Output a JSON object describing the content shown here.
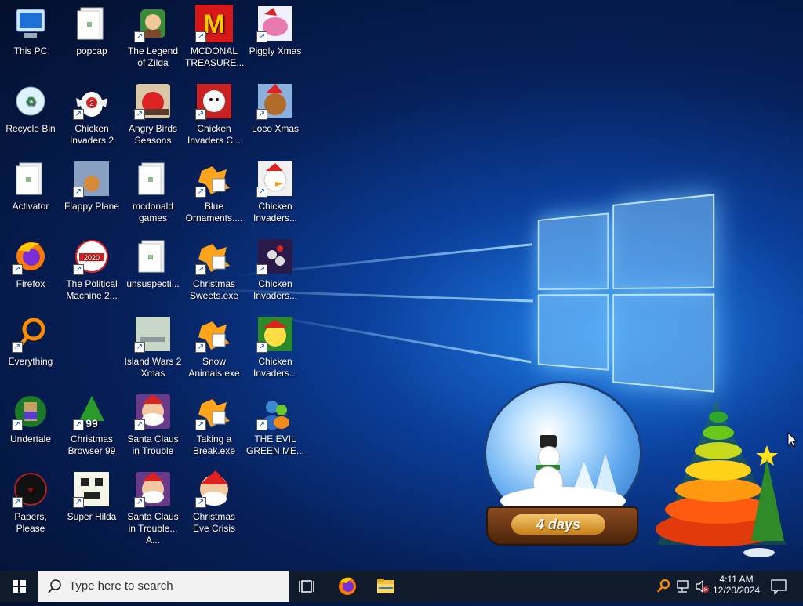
{
  "desktop": {
    "icons": [
      {
        "label": "This PC",
        "col": 0,
        "row": 0,
        "kind": "pc",
        "shortcut": false
      },
      {
        "label": "Recycle Bin",
        "col": 0,
        "row": 1,
        "kind": "bin",
        "shortcut": false
      },
      {
        "label": "Activator",
        "col": 0,
        "row": 2,
        "kind": "folder",
        "shortcut": false
      },
      {
        "label": "Firefox",
        "col": 0,
        "row": 3,
        "kind": "firefox",
        "shortcut": true
      },
      {
        "label": "Everything",
        "col": 0,
        "row": 4,
        "kind": "everything",
        "shortcut": true
      },
      {
        "label": "Undertale",
        "col": 0,
        "row": 5,
        "kind": "undertale",
        "shortcut": true
      },
      {
        "label": "Papers, Please",
        "col": 0,
        "row": 6,
        "kind": "papers",
        "shortcut": true
      },
      {
        "label": "popcap",
        "col": 1,
        "row": 0,
        "kind": "folder",
        "shortcut": false
      },
      {
        "label": "Chicken Invaders 2",
        "col": 1,
        "row": 1,
        "kind": "chicken",
        "shortcut": true
      },
      {
        "label": "Flappy Plane",
        "col": 1,
        "row": 2,
        "kind": "photo",
        "shortcut": true
      },
      {
        "label": "The Political Machine 2...",
        "col": 1,
        "row": 3,
        "kind": "political",
        "shortcut": true
      },
      {
        "label": "Christmas Browser 99",
        "col": 1,
        "row": 5,
        "kind": "xmastree",
        "shortcut": true
      },
      {
        "label": "Super Hilda",
        "col": 1,
        "row": 6,
        "kind": "hilda",
        "shortcut": true
      },
      {
        "label": "The Legend of Zilda",
        "col": 2,
        "row": 0,
        "kind": "zilda",
        "shortcut": true
      },
      {
        "label": "Angry Birds Seasons",
        "col": 2,
        "row": 1,
        "kind": "angry",
        "shortcut": true
      },
      {
        "label": "mcdonald games",
        "col": 2,
        "row": 2,
        "kind": "folder",
        "shortcut": false
      },
      {
        "label": "unsuspecti...",
        "col": 2,
        "row": 3,
        "kind": "folder",
        "shortcut": false
      },
      {
        "label": "Island Wars 2 Xmas",
        "col": 2,
        "row": 4,
        "kind": "island",
        "shortcut": true
      },
      {
        "label": "Santa Claus in Trouble",
        "col": 2,
        "row": 5,
        "kind": "santa",
        "shortcut": true
      },
      {
        "label": "Santa Claus in Trouble... A...",
        "col": 2,
        "row": 6,
        "kind": "santa",
        "shortcut": true
      },
      {
        "label": "MCDONAL TREASURE...",
        "col": 3,
        "row": 0,
        "kind": "mcd",
        "shortcut": true
      },
      {
        "label": "Chicken Invaders C...",
        "col": 3,
        "row": 1,
        "kind": "chickenc",
        "shortcut": true
      },
      {
        "label": "Blue Ornaments....",
        "col": 3,
        "row": 2,
        "kind": "puzzle",
        "shortcut": true
      },
      {
        "label": "Christmas Sweets.exe",
        "col": 3,
        "row": 3,
        "kind": "puzzle",
        "shortcut": true
      },
      {
        "label": "Snow Animals.exe",
        "col": 3,
        "row": 4,
        "kind": "puzzle",
        "shortcut": true
      },
      {
        "label": "Taking a Break.exe",
        "col": 3,
        "row": 5,
        "kind": "puzzle",
        "shortcut": true
      },
      {
        "label": "Christmas Eve Crisis",
        "col": 3,
        "row": 6,
        "kind": "santa2",
        "shortcut": true
      },
      {
        "label": "Piggly Xmas",
        "col": 4,
        "row": 0,
        "kind": "pig",
        "shortcut": true
      },
      {
        "label": "Loco Xmas",
        "col": 4,
        "row": 1,
        "kind": "bear",
        "shortcut": true
      },
      {
        "label": "Chicken Invaders...",
        "col": 4,
        "row": 2,
        "kind": "chickenx",
        "shortcut": true
      },
      {
        "label": "Chicken Invaders...",
        "col": 4,
        "row": 3,
        "kind": "chickeny",
        "shortcut": true
      },
      {
        "label": "Chicken Invaders...",
        "col": 4,
        "row": 4,
        "kind": "chickenz",
        "shortcut": true
      },
      {
        "label": "THE EVIL GREEN ME...",
        "col": 4,
        "row": 5,
        "kind": "msn",
        "shortcut": true
      }
    ]
  },
  "widget": {
    "globe_text": "4 days"
  },
  "taskbar": {
    "search_placeholder": "Type here to search",
    "time": "4:11 AM",
    "date": "12/20/2024"
  },
  "colors": {
    "taskbar": "#0f1a2b",
    "search_bg": "#f2f2f2",
    "accent": "#00a2ff"
  }
}
